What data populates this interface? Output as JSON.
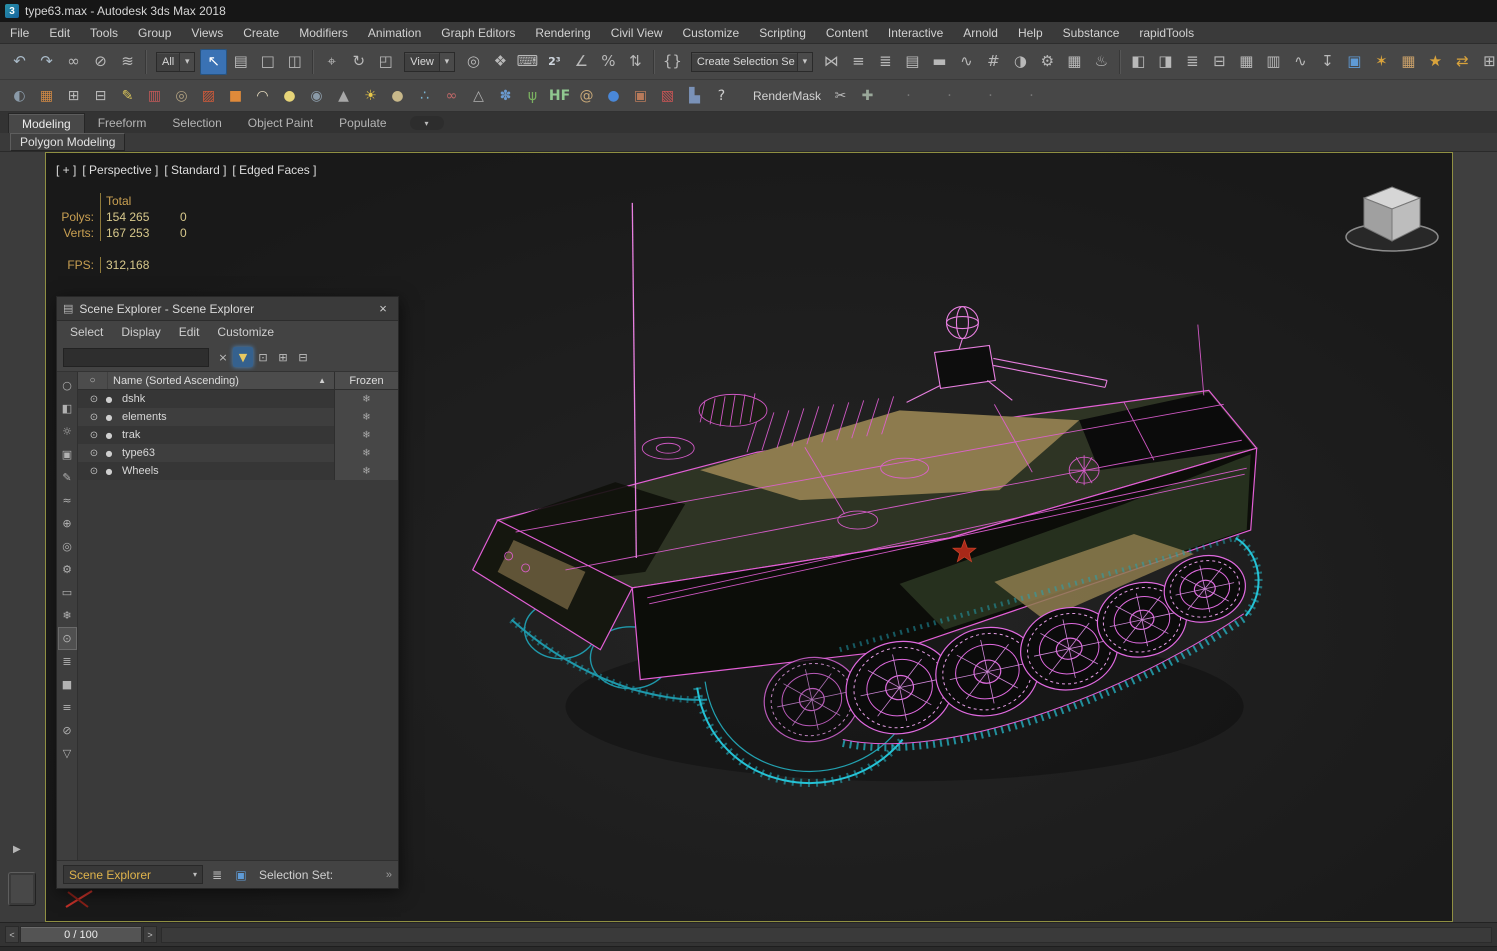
{
  "titlebar": {
    "title": "type63.max - Autodesk 3ds Max 2018",
    "logo_glyph": "3"
  },
  "menubar": {
    "items": [
      {
        "name": "menu-file",
        "label": "File"
      },
      {
        "name": "menu-edit",
        "label": "Edit"
      },
      {
        "name": "menu-tools",
        "label": "Tools"
      },
      {
        "name": "menu-group",
        "label": "Group"
      },
      {
        "name": "menu-views",
        "label": "Views"
      },
      {
        "name": "menu-create",
        "label": "Create"
      },
      {
        "name": "menu-modifiers",
        "label": "Modifiers"
      },
      {
        "name": "menu-animation",
        "label": "Animation"
      },
      {
        "name": "menu-graph-editors",
        "label": "Graph Editors"
      },
      {
        "name": "menu-rendering",
        "label": "Rendering"
      },
      {
        "name": "menu-civil-view",
        "label": "Civil View"
      },
      {
        "name": "menu-customize",
        "label": "Customize"
      },
      {
        "name": "menu-scripting",
        "label": "Scripting"
      },
      {
        "name": "menu-content",
        "label": "Content"
      },
      {
        "name": "menu-interactive",
        "label": "Interactive"
      },
      {
        "name": "menu-arnold",
        "label": "Arnold"
      },
      {
        "name": "menu-help",
        "label": "Help"
      },
      {
        "name": "menu-substance",
        "label": "Substance"
      },
      {
        "name": "menu-rapidtools",
        "label": "rapidTools"
      }
    ]
  },
  "toolbar_main": {
    "filter_value": "All",
    "coord_value": "View",
    "named_value": "Create Selection Se",
    "group1": [
      {
        "name": "undo-icon",
        "glyph": "↶",
        "color": "#a9bac8"
      },
      {
        "name": "redo-icon",
        "glyph": "↷",
        "color": "#a9bac8"
      },
      {
        "name": "select-and-link-icon",
        "glyph": "∞",
        "color": "#b9b9b9"
      },
      {
        "name": "unlink-selection-icon",
        "glyph": "⊘",
        "color": "#b9b9b9"
      },
      {
        "name": "bind-to-space-warp-icon",
        "glyph": "≋",
        "color": "#b9b9b9"
      }
    ],
    "group2": [
      {
        "name": "select-object-icon",
        "glyph": "↖",
        "color": "#ffffff",
        "cls": "active"
      },
      {
        "name": "select-by-name-icon",
        "glyph": "▤",
        "color": "#b9b9b9"
      },
      {
        "name": "rectangular-selection-region-icon",
        "glyph": "□",
        "color": "#b9b9b9"
      },
      {
        "name": "window-crossing-icon",
        "glyph": "◫",
        "color": "#b9b9b9"
      }
    ],
    "group3": [
      {
        "name": "select-and-move-icon",
        "glyph": "⌖",
        "color": "#b9b9b9"
      },
      {
        "name": "select-and-rotate-icon",
        "glyph": "↻",
        "color": "#b9b9b9"
      },
      {
        "name": "select-and-scale-icon",
        "glyph": "◰",
        "color": "#b9b9b9"
      }
    ],
    "group4": [
      {
        "name": "use-pivot-center-icon",
        "glyph": "◎",
        "color": "#b9b9b9"
      },
      {
        "name": "select-and-manipulate-icon",
        "glyph": "❖",
        "color": "#b9b9b9"
      },
      {
        "name": "keyboard-override-icon",
        "glyph": "⌨",
        "color": "#b9b9b9"
      },
      {
        "name": "snaps-toggle-icon",
        "glyph": "2³",
        "color": "#cfd6de",
        "cls": "txt2"
      },
      {
        "name": "angle-snap-icon",
        "glyph": "∠",
        "color": "#b9b9b9"
      },
      {
        "name": "percent-snap-icon",
        "glyph": "%",
        "color": "#b9b9b9"
      },
      {
        "name": "spinner-snap-icon",
        "glyph": "⇅",
        "color": "#b9b9b9"
      }
    ],
    "group5": [
      {
        "name": "edit-named-selection-sets-icon",
        "glyph": "{}",
        "color": "#b9b9b9"
      }
    ],
    "group6": [
      {
        "name": "mirror-icon",
        "glyph": "⋈",
        "color": "#b9b9b9"
      },
      {
        "name": "align-icon",
        "glyph": "≡",
        "color": "#b9b9b9"
      },
      {
        "name": "layer-manager-icon",
        "glyph": "≣",
        "color": "#b9b9b9"
      },
      {
        "name": "toggle-scene-explorer-icon",
        "glyph": "▤",
        "color": "#b9b9b9"
      },
      {
        "name": "toggle-ribbon-icon",
        "glyph": "▬",
        "color": "#b9b9b9"
      },
      {
        "name": "curve-editor-icon",
        "glyph": "∿",
        "color": "#b9b9b9"
      },
      {
        "name": "schematic-view-icon",
        "glyph": "#",
        "color": "#b9b9b9"
      },
      {
        "name": "material-editor-icon",
        "glyph": "◑",
        "color": "#b9b9b9"
      },
      {
        "name": "render-setup-icon",
        "glyph": "⚙",
        "color": "#b9b9b9"
      },
      {
        "name": "rendered-frame-window-icon",
        "glyph": "▦",
        "color": "#b9b9b9"
      },
      {
        "name": "render-production-icon",
        "glyph": "♨",
        "color": "#b9b9b9"
      }
    ],
    "group7": [
      {
        "name": "viewport-layout-icon",
        "glyph": "◧",
        "color": "#b9b9b9"
      },
      {
        "name": "dock-explorer-icon",
        "glyph": "◨",
        "color": "#b9b9b9"
      },
      {
        "name": "layer-explorer-icon",
        "glyph": "≣",
        "color": "#b9b9b9"
      },
      {
        "name": "container-explorer-icon",
        "glyph": "⊟",
        "color": "#b9b9b9"
      },
      {
        "name": "track-view-icon",
        "glyph": "▦",
        "color": "#b9b9b9"
      },
      {
        "name": "grid-view-icon",
        "glyph": "▥",
        "color": "#b9b9b9"
      },
      {
        "name": "curve-graph-icon",
        "glyph": "∿",
        "color": "#b9b9b9"
      },
      {
        "name": "download-icon",
        "glyph": "↧",
        "color": "#b9b9b9"
      },
      {
        "name": "render-big-icon",
        "glyph": "▣",
        "color": "#5f9bd6"
      },
      {
        "name": "settings-star-icon",
        "glyph": "✶",
        "color": "#d9a33c"
      },
      {
        "name": "snapshot-icon",
        "glyph": "▦",
        "color": "#c9a06a"
      },
      {
        "name": "favorite-star-icon",
        "glyph": "★",
        "color": "#d9a33c"
      },
      {
        "name": "swap-arrows-icon",
        "glyph": "⇄",
        "color": "#d9a33c"
      },
      {
        "name": "window-grid-icon",
        "glyph": "⊞",
        "color": "#b9b9b9"
      }
    ]
  },
  "toolbar_secondary": {
    "rendermask_label": "RenderMask",
    "icons": [
      {
        "name": "eclipse-sphere-icon",
        "glyph": "◐",
        "color": "#8a9aa8"
      },
      {
        "name": "checker-bitmap-icon",
        "glyph": "▦",
        "color": "#cf8844"
      },
      {
        "name": "grid-a-icon",
        "glyph": "⊞",
        "color": "#b9b9b9"
      },
      {
        "name": "grid-b-icon",
        "glyph": "⊟",
        "color": "#b9b9b9"
      },
      {
        "name": "eyedropper-icon",
        "glyph": "✎",
        "color": "#d8c35a"
      },
      {
        "name": "film-values-icon",
        "glyph": "▥",
        "color": "#c05858"
      },
      {
        "name": "target-spiral-icon",
        "glyph": "◎",
        "color": "#b0a080"
      },
      {
        "name": "swatch-red-icon",
        "glyph": "▨",
        "color": "#d05a3a"
      },
      {
        "name": "swatch-orange-icon",
        "glyph": "■",
        "color": "#e08a3a"
      },
      {
        "name": "dome-icon",
        "glyph": "◠",
        "color": "#e8ddc0"
      },
      {
        "name": "sphere-yellow-icon",
        "glyph": "●",
        "color": "#e6d478"
      },
      {
        "name": "wire-sphere-icon",
        "glyph": "◉",
        "color": "#8a9aa8"
      },
      {
        "name": "cone-icon",
        "glyph": "▲",
        "color": "#a8a8a8"
      },
      {
        "name": "sun-icon",
        "glyph": "☀",
        "color": "#e8c84a"
      },
      {
        "name": "sphere-tan-icon",
        "glyph": "●",
        "color": "#c8b88a"
      },
      {
        "name": "scatter-points-icon",
        "glyph": "∴",
        "color": "#7ab3d0"
      },
      {
        "name": "two-spheres-icon",
        "glyph": "∞",
        "color": "#c06868"
      },
      {
        "name": "pyramid-icon",
        "glyph": "△",
        "color": "#b0b0b0"
      },
      {
        "name": "gear-flower-icon",
        "glyph": "✽",
        "color": "#6a9ad0"
      },
      {
        "name": "grass-icon",
        "glyph": "ψ",
        "color": "#7ab060"
      },
      {
        "name": "hf-tool-icon",
        "glyph": "HF",
        "color": "#90c890",
        "cls": "txt"
      },
      {
        "name": "shell-icon",
        "glyph": "@",
        "color": "#c8a878"
      },
      {
        "name": "sphere-blue-icon",
        "glyph": "●",
        "color": "#4a88d8"
      },
      {
        "name": "camera-box-icon",
        "glyph": "▣",
        "color": "#b87a5a"
      },
      {
        "name": "color-cube-icon",
        "glyph": "▧",
        "color": "#cc5555"
      },
      {
        "name": "stats-chart-icon",
        "glyph": "▙",
        "color": "#7a92b8"
      },
      {
        "name": "help-icon",
        "glyph": "?",
        "color": "#cfcfcf"
      }
    ],
    "trailing": [
      {
        "name": "scissors-icon",
        "glyph": "✂",
        "color": "#b9b9b9"
      },
      {
        "name": "add-plus-icon",
        "glyph": "✚",
        "color": "#9aa89a"
      }
    ],
    "disabled_slots": [
      {
        "name": "disabled-slot-icon",
        "glyph": "·"
      },
      {
        "name": "disabled-slot-icon",
        "glyph": "·"
      },
      {
        "name": "disabled-slot-icon",
        "glyph": "·"
      },
      {
        "name": "disabled-slot-icon",
        "glyph": "·"
      }
    ]
  },
  "ribbon": {
    "tabs": [
      {
        "name": "tab-modeling",
        "label": "Modeling",
        "cls": "active"
      },
      {
        "name": "tab-freeform",
        "label": "Freeform"
      },
      {
        "name": "tab-selection",
        "label": "Selection"
      },
      {
        "name": "tab-object-paint",
        "label": "Object Paint"
      },
      {
        "name": "tab-populate",
        "label": "Populate"
      }
    ],
    "panel_label": "Polygon Modeling"
  },
  "viewport": {
    "label_parts": [
      {
        "text": "[ + ]"
      },
      {
        "text": "[ Perspective ]"
      },
      {
        "text": "[ Standard ]"
      },
      {
        "text": "[ Edged Faces ]"
      }
    ],
    "stats": {
      "header": "Total",
      "polys_label": "Polys:",
      "polys_value": "154 265",
      "polys_sel": "0",
      "verts_label": "Verts:",
      "verts_value": "167 253",
      "verts_sel": "0",
      "fps_label": "FPS:",
      "fps_value": "312,168"
    }
  },
  "scene_explorer": {
    "title": "Scene Explorer - Scene Explorer",
    "menus": [
      {
        "name": "se-menu-select",
        "label": "Select"
      },
      {
        "name": "se-menu-display",
        "label": "Display"
      },
      {
        "name": "se-menu-edit",
        "label": "Edit"
      },
      {
        "name": "se-menu-customize",
        "label": "Customize"
      }
    ],
    "toolbar": [
      {
        "name": "clear-search-icon",
        "glyph": "×"
      },
      {
        "name": "filter-funnel-icon",
        "glyph": "▼",
        "cls": "active"
      },
      {
        "name": "lock-icon",
        "glyph": "⊡"
      },
      {
        "name": "add-column-icon",
        "glyph": "⊞"
      },
      {
        "name": "remove-column-icon",
        "glyph": "⊟"
      }
    ],
    "strip": [
      {
        "name": "display-none-icon",
        "glyph": "○"
      },
      {
        "name": "display-geometry-icon",
        "glyph": "◧"
      },
      {
        "name": "display-lights-icon",
        "glyph": "☼"
      },
      {
        "name": "display-cameras-icon",
        "glyph": "▣"
      },
      {
        "name": "display-shapes-icon",
        "glyph": "✎"
      },
      {
        "name": "display-spacewarps-icon",
        "glyph": "≈"
      },
      {
        "name": "display-helpers-icon",
        "glyph": "⊕"
      },
      {
        "name": "display-xrefs-icon",
        "glyph": "◎"
      },
      {
        "name": "display-bones-icon",
        "glyph": "⚙"
      },
      {
        "name": "display-containers-icon",
        "glyph": "▭"
      },
      {
        "name": "filter-frozen-icon",
        "glyph": "❄"
      },
      {
        "name": "filter-hidden-icon",
        "glyph": "⊙",
        "cls": "pressed"
      },
      {
        "name": "list-view-icon",
        "glyph": "≣"
      },
      {
        "name": "thumbnail-view-icon",
        "glyph": "■"
      },
      {
        "name": "detail-view-icon",
        "glyph": "≡"
      },
      {
        "name": "clear-filter-icon",
        "glyph": "⊘"
      },
      {
        "name": "custom-filter-icon",
        "glyph": "▽"
      }
    ],
    "header": {
      "name_label": "Name (Sorted Ascending)",
      "frozen_label": "Frozen"
    },
    "rows": [
      {
        "name": "row-dshk",
        "label": "dshk"
      },
      {
        "name": "row-elements",
        "label": "elements"
      },
      {
        "name": "row-trak",
        "label": "trak"
      },
      {
        "name": "row-type63",
        "label": "type63"
      },
      {
        "name": "row-wheels",
        "label": "Wheels"
      }
    ],
    "footer": {
      "explorer_name": "Scene Explorer",
      "selection_set_label": "Selection Set:",
      "chevrons": "»"
    }
  },
  "timeline": {
    "step_back": "<",
    "frame_display": "0 / 100",
    "step_forward": ">"
  },
  "sidebar": {
    "expand_arrow": "▶"
  },
  "icons": {
    "chevron_down": "▾",
    "close": "×",
    "sort_asc": "▲",
    "snowflake": "❄",
    "eye": "⊙",
    "dot": "●",
    "circle": "○",
    "window": "▤"
  },
  "colors": {
    "wireframe_pink": "#e35fd6",
    "track_cyan": "#25c3d6",
    "viewport_border": "#8f8f42",
    "stats_gold": "#c9a052",
    "explorer_name_yellow": "#e0b44c"
  }
}
